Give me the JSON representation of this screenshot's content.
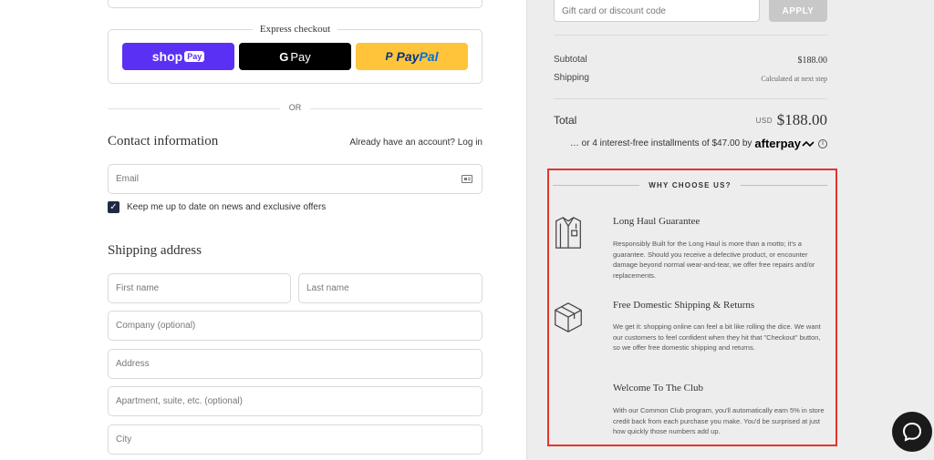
{
  "express": {
    "title": "Express checkout",
    "shop_pay_label": "shop",
    "shop_pay_badge": "Pay",
    "gpay_g": "G",
    "gpay_label": "Pay",
    "paypal_pay": "Pay",
    "paypal_pal": "Pal"
  },
  "divider": {
    "or": "OR"
  },
  "contact": {
    "title": "Contact information",
    "account_prompt": "Already have an account?",
    "login_link": "Log in",
    "email_placeholder": "Email",
    "newsletter_label": "Keep me up to date on news and exclusive offers",
    "newsletter_checked": true
  },
  "shipping": {
    "title": "Shipping address",
    "first_name": "First name",
    "last_name": "Last name",
    "company": "Company (optional)",
    "address": "Address",
    "apartment": "Apartment, suite, etc. (optional)",
    "city": "City"
  },
  "summary": {
    "gift_placeholder": "Gift card or discount code",
    "apply_label": "APPLY",
    "subtotal_label": "Subtotal",
    "subtotal_value": "$188.00",
    "shipping_label": "Shipping",
    "shipping_value": "Calculated at next step",
    "total_label": "Total",
    "total_currency": "USD",
    "total_value": "$188.00",
    "afterpay_text": "… or 4 interest-free installments of $47.00 by",
    "afterpay_brand": "afterpay",
    "afterpay_info": "i"
  },
  "why": {
    "title": "WHY CHOOSE US?",
    "features": [
      {
        "icon": "shirt-icon",
        "title": "Long Haul Guarantee",
        "body": "Responsibly Built for the Long Haul is more than a motto; it's a guarantee. Should you receive a defective product, or encounter damage beyond normal wear-and-tear, we offer free repairs and/or replacements."
      },
      {
        "icon": "box-icon",
        "title": "Free Domestic Shipping & Returns",
        "body": "We get it: shopping online can feel a bit like rolling the dice. We want our customers to feel confident when they hit that \"Checkout\" button, so we offer free domestic shipping and returns."
      },
      {
        "icon": "",
        "title": "Welcome To The Club",
        "body": "With our Common Club program, you'll automatically earn 5% in store credit back from each purchase you make. You'd be surprised at just how quickly those numbers add up."
      }
    ]
  },
  "colors": {
    "shop_pay": "#5a31f4",
    "paypal": "#ffc439",
    "highlight_border": "#e3342f"
  }
}
